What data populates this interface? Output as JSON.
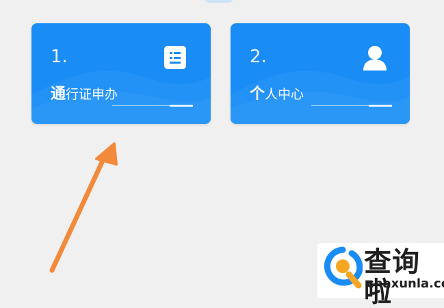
{
  "cards": [
    {
      "number": "1.",
      "label_first": "通",
      "label_rest": "行证申办",
      "icon": "document-list-icon"
    },
    {
      "number": "2.",
      "label_first": "个",
      "label_rest": "人中心",
      "icon": "user-icon"
    }
  ],
  "watermark": {
    "title": "查询啦",
    "url": "chaxunla.com"
  },
  "colors": {
    "card": "#1a8cf5",
    "arrow": "#f28a3c",
    "background": "#f0f0f0",
    "logo_blue": "#1a8cf5",
    "logo_orange": "#f5a623"
  }
}
